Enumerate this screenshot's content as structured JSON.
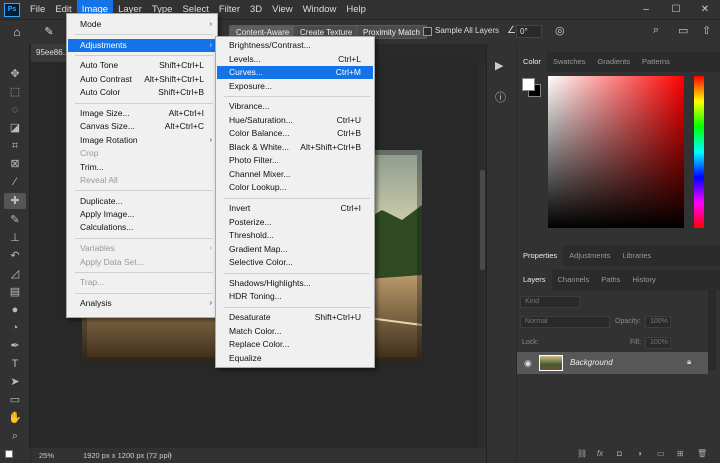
{
  "menubar": {
    "logo": "Ps",
    "items": [
      "File",
      "Edit",
      "Image",
      "Layer",
      "Type",
      "Select",
      "Filter",
      "3D",
      "View",
      "Window",
      "Help"
    ],
    "active": "Image",
    "minimize": "–",
    "maximize": "☐",
    "close": "✕"
  },
  "options": {
    "content_aware": "Content-Aware",
    "create_texture": "Create Texture",
    "proximity_match": "Proximity Match",
    "sample_all_label": "Sample All Layers",
    "angle": "0°"
  },
  "document": {
    "tab": "95ee86...",
    "zoom": "25%",
    "dimensions": "1920 px x 1200 px (72 ppi)"
  },
  "image_menu": [
    {
      "label": "Mode",
      "arrow": "›"
    },
    {
      "sep": true
    },
    {
      "label": "Adjustments",
      "arrow": "›",
      "highlight": true
    },
    {
      "sep": true
    },
    {
      "label": "Auto Tone",
      "shortcut": "Shift+Ctrl+L"
    },
    {
      "label": "Auto Contrast",
      "shortcut": "Alt+Shift+Ctrl+L"
    },
    {
      "label": "Auto Color",
      "shortcut": "Shift+Ctrl+B"
    },
    {
      "sep": true
    },
    {
      "label": "Image Size...",
      "shortcut": "Alt+Ctrl+I"
    },
    {
      "label": "Canvas Size...",
      "shortcut": "Alt+Ctrl+C"
    },
    {
      "label": "Image Rotation",
      "arrow": "›"
    },
    {
      "label": "Crop",
      "disabled": true
    },
    {
      "label": "Trim..."
    },
    {
      "label": "Reveal All",
      "disabled": true
    },
    {
      "sep": true
    },
    {
      "label": "Duplicate..."
    },
    {
      "label": "Apply Image..."
    },
    {
      "label": "Calculations..."
    },
    {
      "sep": true
    },
    {
      "label": "Variables",
      "arrow": "›",
      "disabled": true
    },
    {
      "label": "Apply Data Set...",
      "disabled": true
    },
    {
      "sep": true
    },
    {
      "label": "Trap...",
      "disabled": true
    },
    {
      "sep": true
    },
    {
      "label": "Analysis",
      "arrow": "›"
    }
  ],
  "adjustments_menu": [
    {
      "label": "Brightness/Contrast..."
    },
    {
      "label": "Levels...",
      "shortcut": "Ctrl+L"
    },
    {
      "label": "Curves...",
      "shortcut": "Ctrl+M",
      "highlight": true
    },
    {
      "label": "Exposure..."
    },
    {
      "sep": true
    },
    {
      "label": "Vibrance..."
    },
    {
      "label": "Hue/Saturation...",
      "shortcut": "Ctrl+U"
    },
    {
      "label": "Color Balance...",
      "shortcut": "Ctrl+B"
    },
    {
      "label": "Black & White...",
      "shortcut": "Alt+Shift+Ctrl+B"
    },
    {
      "label": "Photo Filter..."
    },
    {
      "label": "Channel Mixer..."
    },
    {
      "label": "Color Lookup..."
    },
    {
      "sep": true
    },
    {
      "label": "Invert",
      "shortcut": "Ctrl+I"
    },
    {
      "label": "Posterize..."
    },
    {
      "label": "Threshold..."
    },
    {
      "label": "Gradient Map..."
    },
    {
      "label": "Selective Color..."
    },
    {
      "sep": true
    },
    {
      "label": "Shadows/Highlights..."
    },
    {
      "label": "HDR Toning..."
    },
    {
      "sep": true
    },
    {
      "label": "Desaturate",
      "shortcut": "Shift+Ctrl+U"
    },
    {
      "label": "Match Color..."
    },
    {
      "label": "Replace Color..."
    },
    {
      "label": "Equalize"
    }
  ],
  "panels": {
    "color_tabs": [
      "Color",
      "Swatches",
      "Gradients",
      "Patterns"
    ],
    "props_tabs": [
      "Properties",
      "Adjustments",
      "Libraries"
    ],
    "layer_tabs": [
      "Layers",
      "Channels",
      "Paths",
      "History"
    ],
    "kind": "Kind",
    "blend": "Normal",
    "opacity_label": "Opacity:",
    "opacity": "100%",
    "lock_label": "Lock:",
    "fill_label": "Fill:",
    "fill": "100%",
    "layer_name": "Background"
  },
  "colors": {
    "accent": "#1473e6",
    "fg": "#ffffff",
    "bg": "#000000"
  }
}
